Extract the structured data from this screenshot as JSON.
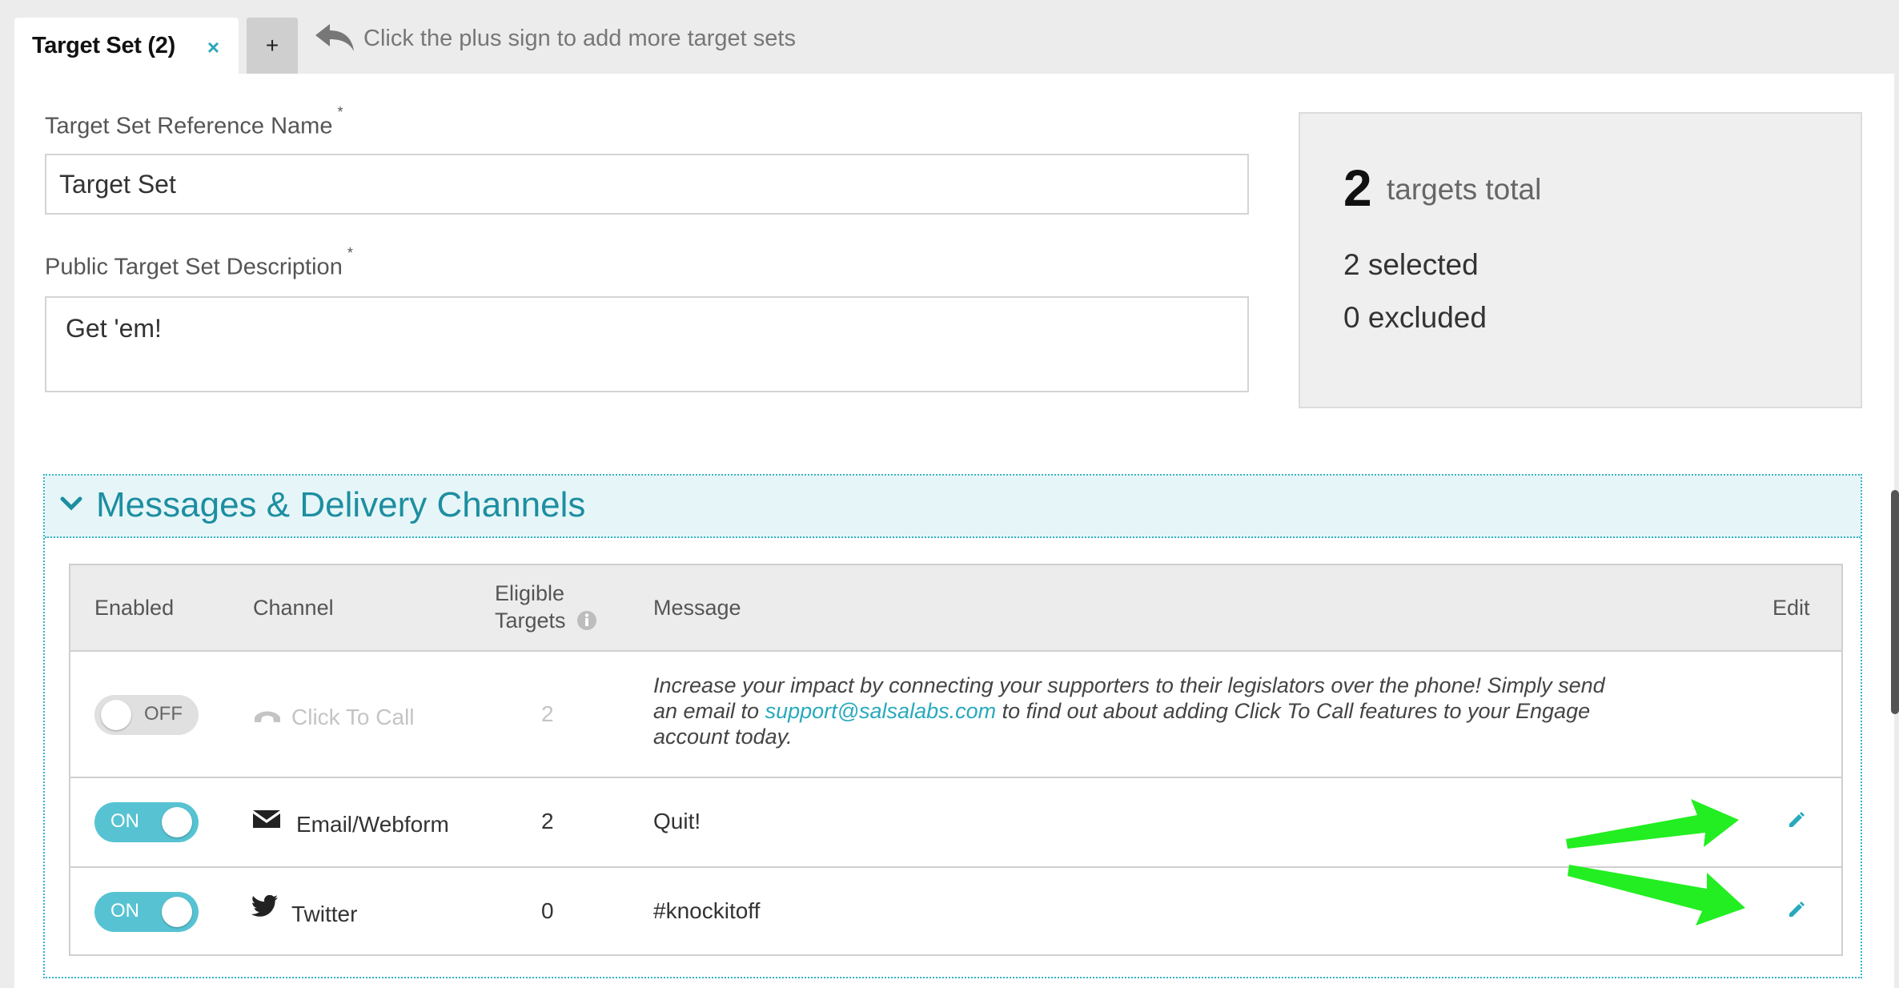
{
  "tabs": {
    "active_label": "Target Set (2)",
    "close_symbol": "×",
    "add_symbol": "+",
    "hint": "Click the plus sign to add more target sets"
  },
  "form": {
    "reference_name_label": "Target Set Reference Name",
    "reference_name_value": "Target Set",
    "description_label": "Public Target Set Description",
    "description_value": "Get 'em!",
    "required_marker": "*"
  },
  "summary": {
    "count": "2",
    "total_label": "targets total",
    "selected": "2 selected",
    "excluded": "0 excluded"
  },
  "section": {
    "title": "Messages & Delivery Channels",
    "columns": {
      "enabled": "Enabled",
      "channel": "Channel",
      "eligible_line1": "Eligible",
      "eligible_line2": "Targets",
      "message": "Message",
      "edit": "Edit"
    },
    "rows": [
      {
        "toggle": "OFF",
        "channel": "Click To Call",
        "icon": "phone-icon",
        "eligible": "2",
        "message_pre": "Increase your impact by connecting your supporters to their legislators over the phone! Simply send an email to ",
        "message_link": "support@salsalabs.com",
        "message_post": " to find out about adding Click To Call features to your Engage account today."
      },
      {
        "toggle": "ON",
        "channel": "Email/Webform",
        "icon": "envelope-icon",
        "eligible": "2",
        "message": "Quit!"
      },
      {
        "toggle": "ON",
        "channel": "Twitter",
        "icon": "twitter-icon",
        "eligible": "0",
        "message": "#knockitoff"
      }
    ]
  },
  "colors": {
    "accent": "#57c3d2",
    "title_teal": "#1d8ea1",
    "annotation_green": "#22ee22"
  }
}
